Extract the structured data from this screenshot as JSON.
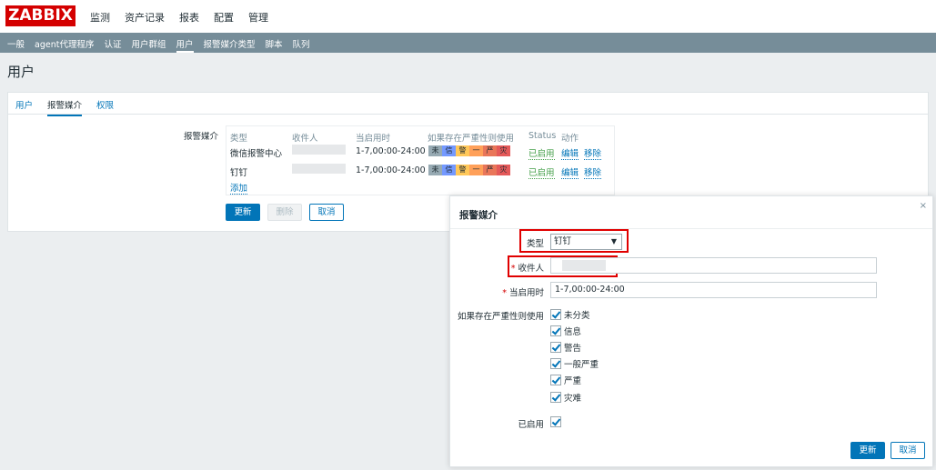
{
  "app": {
    "logo": "ZABBIX"
  },
  "main_nav": [
    "监测",
    "资产记录",
    "报表",
    "配置",
    "管理"
  ],
  "sub_nav": {
    "items": [
      "一般",
      "agent代理程序",
      "认证",
      "用户群组",
      "用户",
      "报警媒介类型",
      "脚本",
      "队列"
    ],
    "active": "用户"
  },
  "page": {
    "title": "用户"
  },
  "tabs": [
    "用户",
    "报警媒介",
    "权限"
  ],
  "media": {
    "label": "报警媒介",
    "headers": {
      "type": "类型",
      "recipient": "收件人",
      "when_active": "当启用时",
      "severity": "如果存在严重性则使用",
      "status": "Status",
      "action": "动作"
    },
    "rows": [
      {
        "type": "微信报警中心",
        "when_active": "1-7,00:00-24:00",
        "status": "已启用",
        "edit": "编辑",
        "remove": "移除"
      },
      {
        "type": "钉钉",
        "when_active": "1-7,00:00-24:00",
        "status": "已启用",
        "edit": "编辑",
        "remove": "移除"
      }
    ],
    "severity_short": [
      "未",
      "信",
      "警",
      "一",
      "严",
      "灾"
    ],
    "add": "添加"
  },
  "form_buttons": {
    "update": "更新",
    "delete": "删除",
    "cancel": "取消"
  },
  "dialog": {
    "title": "报警媒介",
    "close": "×",
    "type_label": "类型",
    "type_value": "钉钉",
    "recipient_label": "收件人",
    "recipient_value": "",
    "when_active_label": "当启用时",
    "when_active_value": "1-7,00:00-24:00",
    "severity_label": "如果存在严重性则使用",
    "severities": [
      "未分类",
      "信息",
      "警告",
      "一般严重",
      "严重",
      "灾难"
    ],
    "enabled_label": "已启用",
    "update": "更新",
    "cancel": "取消"
  }
}
